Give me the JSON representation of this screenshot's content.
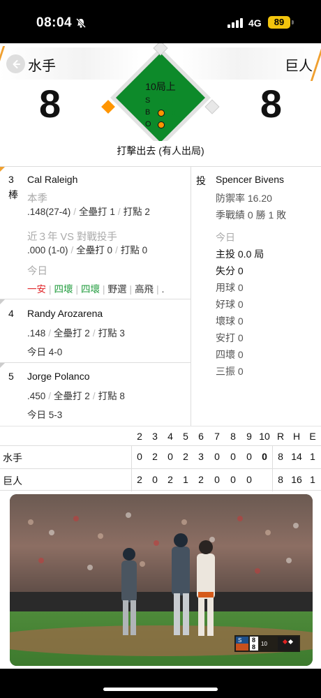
{
  "status_bar": {
    "time": "08:04",
    "network": "4G",
    "battery": "89"
  },
  "game": {
    "away_team": "水手",
    "home_team": "巨人",
    "away_score": "8",
    "home_score": "8",
    "inning": "10局上",
    "count": {
      "strikes": 0,
      "balls": 1,
      "outs": 1
    },
    "count_labels": [
      "S",
      "B",
      "O"
    ],
    "last_play": "打擊出去 (有人出局)"
  },
  "batters": [
    {
      "order": "3",
      "order_sub": "棒",
      "name": "Cal Raleigh",
      "season_label": "本季",
      "season": {
        "avg": ".148(27-4)",
        "hr": "全壘打 1",
        "rbi": "打點 2"
      },
      "vs_label": "近３年 VS 對戰投手",
      "vs": {
        "avg": ".000 (1-0)",
        "hr": "全壘打 0",
        "rbi": "打點 0"
      },
      "today_label": "今日",
      "today": [
        "一安",
        "四壞",
        "四壞",
        "野選",
        "高飛",
        "."
      ]
    },
    {
      "order": "4",
      "name": "Randy Arozarena",
      "line": {
        "avg": ".148",
        "hr": "全壘打 2",
        "rbi": "打點 3"
      },
      "today": "今日 4-0"
    },
    {
      "order": "5",
      "name": "Jorge Polanco",
      "line": {
        "avg": ".450",
        "hr": "全壘打 2",
        "rbi": "打點 8"
      },
      "today": "今日 5-3"
    }
  ],
  "pitcher": {
    "label": "投",
    "name": "Spencer Bivens",
    "era": "防禦率 16.20",
    "record": "季戰績 0 勝 1 敗",
    "today_label": "今日",
    "innings": "主投 0.0 局",
    "runs": "失分 0",
    "pitches": "用球 0",
    "strikes": "好球 0",
    "balls": "壞球 0",
    "hits": "安打 0",
    "walks": "四壞 0",
    "strikeouts": "三振 0"
  },
  "linescore": {
    "headers": [
      "2",
      "3",
      "4",
      "5",
      "6",
      "7",
      "8",
      "9",
      "10",
      "R",
      "H",
      "E"
    ],
    "rows": [
      {
        "team": "水手",
        "cells": [
          "0",
          "2",
          "0",
          "2",
          "3",
          "0",
          "0",
          "0",
          "0",
          "8",
          "14",
          "1"
        ]
      },
      {
        "team": "巨人",
        "cells": [
          "2",
          "0",
          "2",
          "1",
          "2",
          "0",
          "0",
          "0",
          "",
          "8",
          "16",
          "1"
        ]
      }
    ]
  },
  "video_overlay": {
    "away_abbr": "S",
    "away_score": "8",
    "home_score": "8",
    "inning": "10"
  },
  "colors": {
    "accent": "#f0a030",
    "field_green": "#0d8a2a",
    "count_on": "#ff9500",
    "hit_red": "#e0262a",
    "walk_green": "#1d9a3a"
  }
}
